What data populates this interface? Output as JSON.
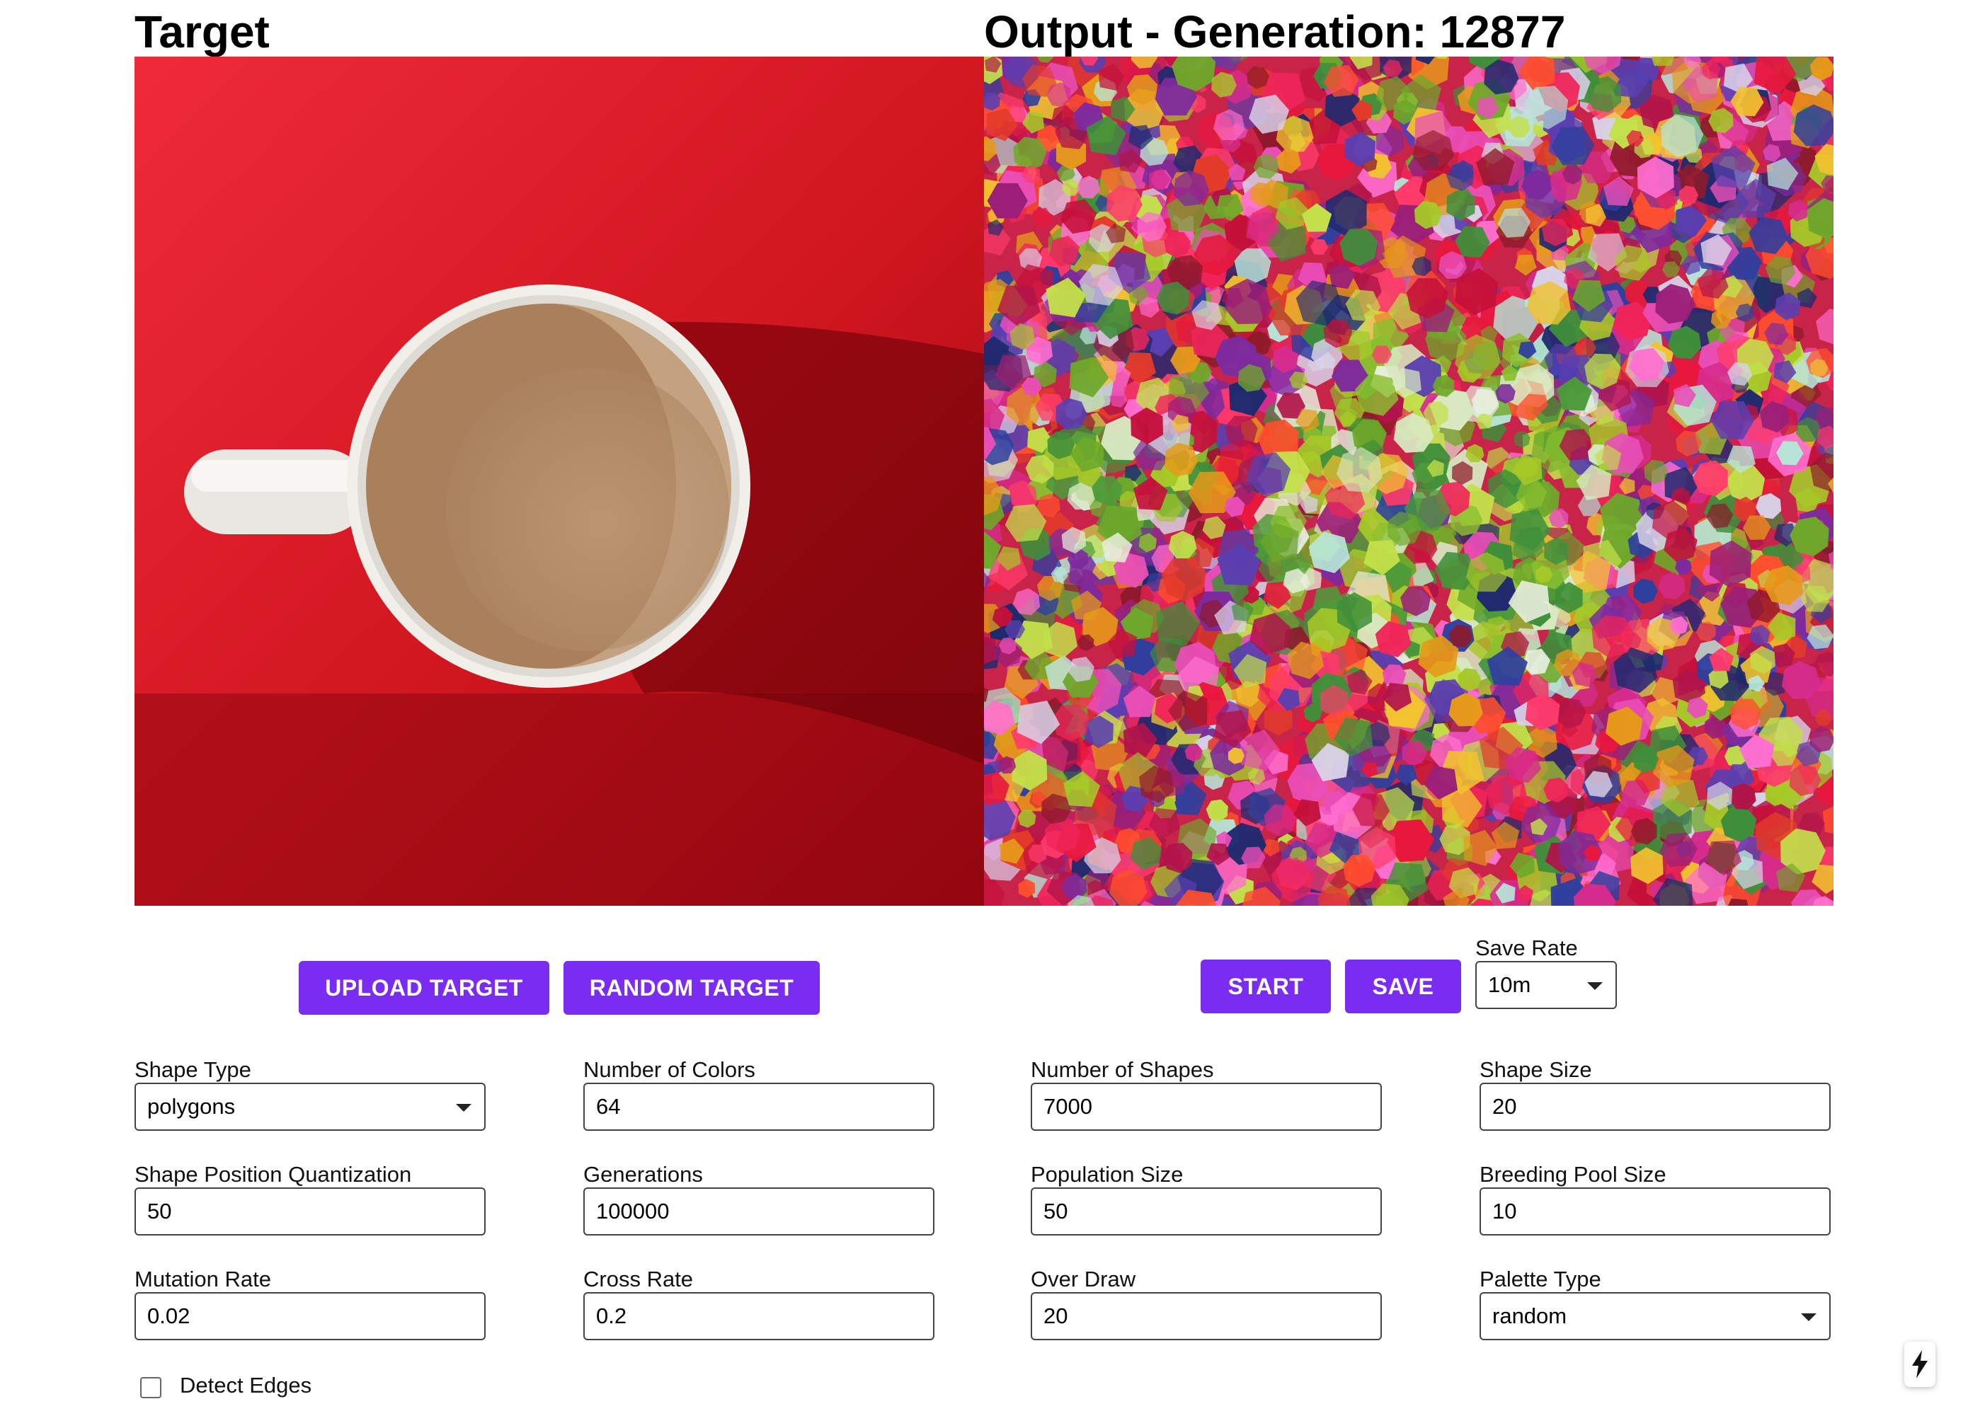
{
  "header": {
    "target_title": "Target",
    "output_title": "Output - Generation: 12877"
  },
  "target_controls": {
    "upload_label": "UPLOAD TARGET",
    "random_label": "RANDOM TARGET"
  },
  "output_controls": {
    "start_label": "START",
    "save_label": "SAVE",
    "save_rate_label": "Save Rate",
    "save_rate_value": "10m"
  },
  "settings": {
    "shape_type": {
      "label": "Shape Type",
      "value": "polygons"
    },
    "number_of_colors": {
      "label": "Number of Colors",
      "value": "64"
    },
    "number_of_shapes": {
      "label": "Number of Shapes",
      "value": "7000"
    },
    "shape_size": {
      "label": "Shape Size",
      "value": "20"
    },
    "shape_position_quantization": {
      "label": "Shape Position Quantization",
      "value": "50"
    },
    "generations": {
      "label": "Generations",
      "value": "100000"
    },
    "population_size": {
      "label": "Population Size",
      "value": "50"
    },
    "breeding_pool_size": {
      "label": "Breeding Pool Size",
      "value": "10"
    },
    "mutation_rate": {
      "label": "Mutation Rate",
      "value": "0.02"
    },
    "cross_rate": {
      "label": "Cross Rate",
      "value": "0.2"
    },
    "over_draw": {
      "label": "Over Draw",
      "value": "20"
    },
    "palette_type": {
      "label": "Palette Type",
      "value": "random"
    },
    "detect_edges": {
      "label": "Detect Edges",
      "checked": false
    }
  },
  "colors": {
    "accent": "#7a2df0",
    "target_background": "#d41a26"
  },
  "icons": {
    "dropdown": "chevron-down-icon",
    "fab": "lightning-bolt-icon"
  }
}
